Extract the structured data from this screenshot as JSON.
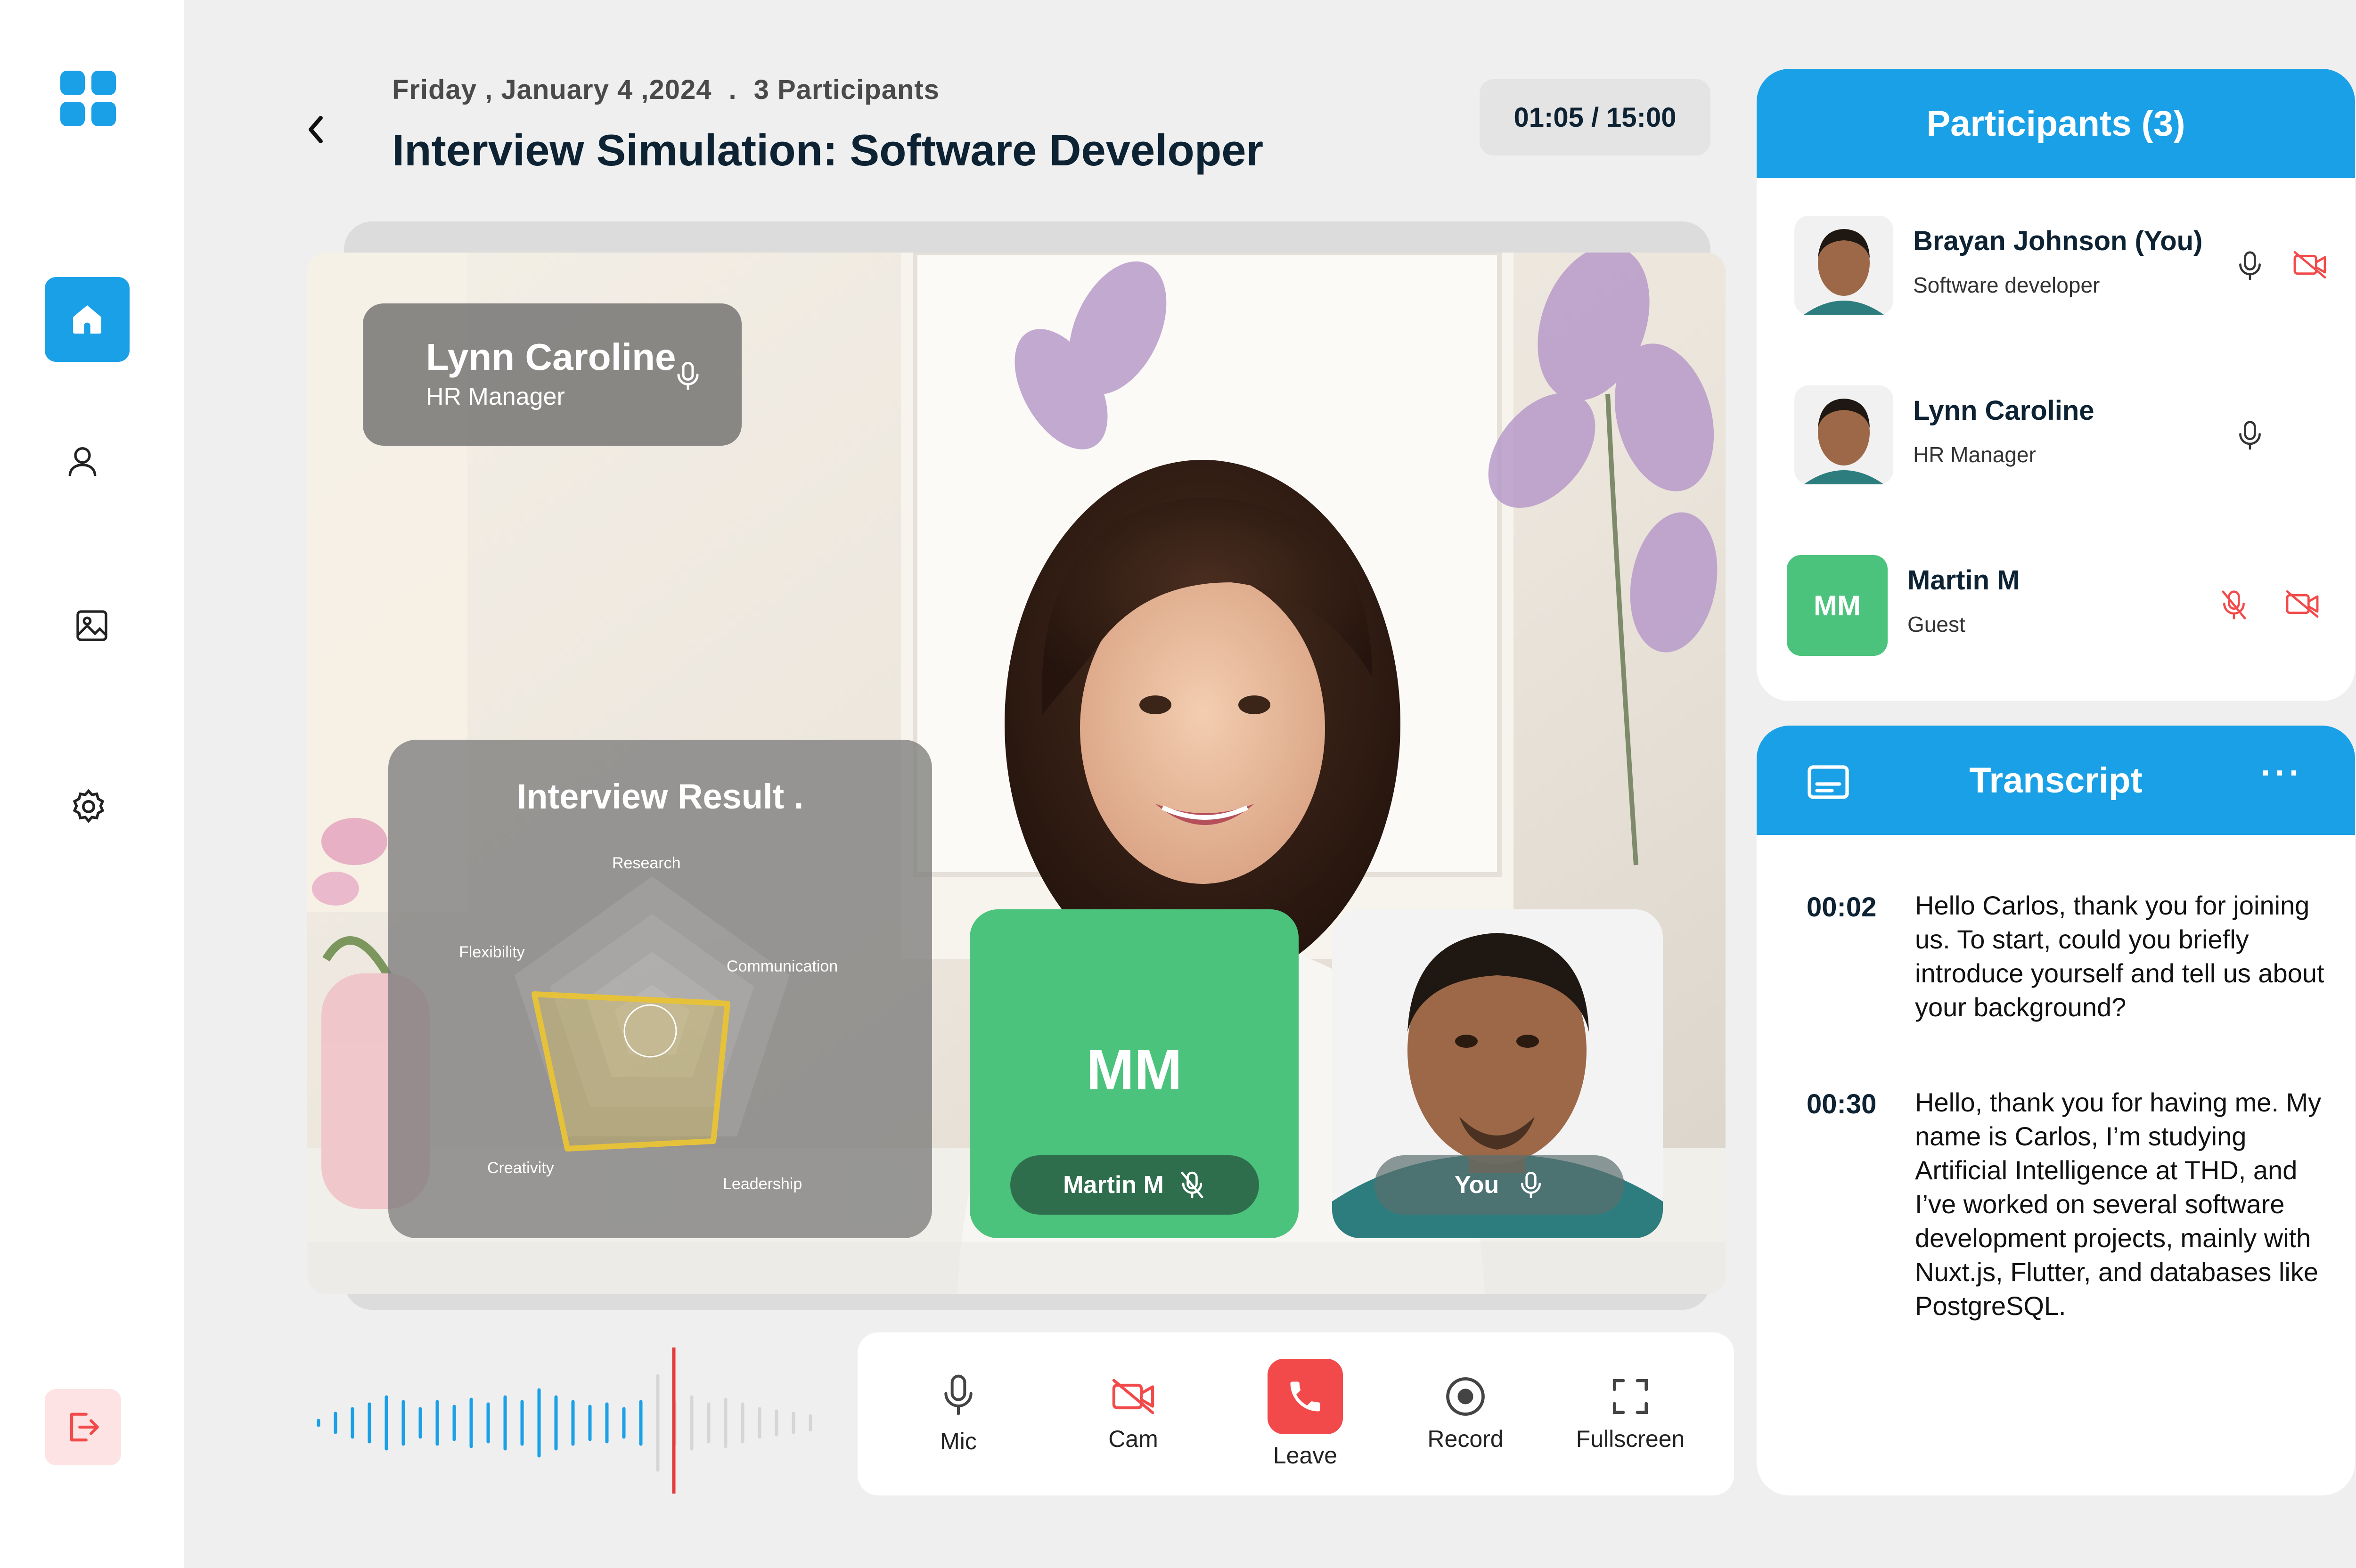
{
  "header": {
    "date": "Friday , January 4 ,2024",
    "separator": ".",
    "participants_count": "3 Participants",
    "title": "Interview Simulation: Software Developer",
    "timer": "01:05 / 15:00"
  },
  "speaker": {
    "name": "Lynn Caroline",
    "role": "HR Manager"
  },
  "result_card": {
    "title": "Interview Result .",
    "labels": [
      "Research",
      "Communication",
      "Leadership",
      "Creativity",
      "Flexibility"
    ]
  },
  "tiles": {
    "guest_initials": "MM",
    "guest_name": "Martin M",
    "self_label": "You"
  },
  "controls": {
    "mic": "Mic",
    "cam": "Cam",
    "leave": "Leave",
    "record": "Record",
    "fullscreen": "Fullscreen"
  },
  "participants": {
    "title": "Participants (3)",
    "list": [
      {
        "name": "Brayan Johnson (You)",
        "role": "Software developer"
      },
      {
        "name": "Lynn Caroline",
        "role": "HR Manager"
      },
      {
        "name": "Martin M",
        "role": "Guest",
        "initials": "MM"
      }
    ]
  },
  "transcript": {
    "title": "Transcript",
    "more": "···",
    "entries": [
      {
        "time": "00:02",
        "text": "Hello Carlos, thank you for joining us. To start, could you briefly introduce yourself and tell us about your background?"
      },
      {
        "time": "00:30",
        "text": "Hello, thank you for having me. My name is Carlos, I’m studying Artificial Intelligence at THD, and I’ve worked on several software development projects, mainly with Nuxt.js, Flutter, and databases like PostgreSQL."
      }
    ]
  },
  "colors": {
    "accent": "#1aa0e6",
    "guest_green": "#4cc37c",
    "danger": "#f24a4a",
    "chart_yellow": "#e6c23a"
  }
}
